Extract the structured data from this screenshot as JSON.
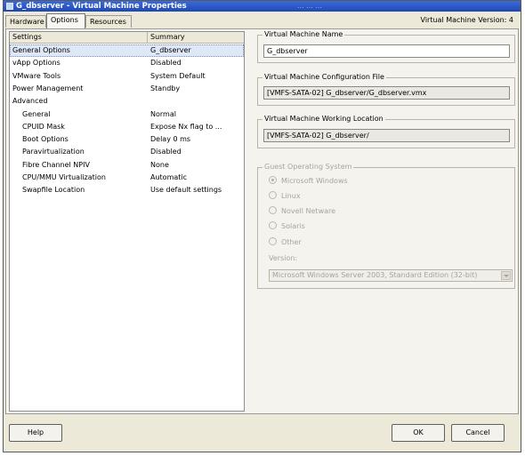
{
  "window": {
    "title": "G_dbserver - Virtual Machine Properties",
    "title_ghost": "... ... ..."
  },
  "tabs": [
    {
      "label": "Hardware",
      "active": false
    },
    {
      "label": "Options",
      "active": true
    },
    {
      "label": "Resources",
      "active": false
    }
  ],
  "version_label": "Virtual Machine Version: 4",
  "settings_table": {
    "columns": [
      "Settings",
      "Summary"
    ],
    "rows": [
      {
        "setting": "General Options",
        "summary": "G_dbserver",
        "indent": false,
        "selected": true
      },
      {
        "setting": "vApp Options",
        "summary": "Disabled",
        "indent": false,
        "selected": false
      },
      {
        "setting": "VMware Tools",
        "summary": "System Default",
        "indent": false,
        "selected": false
      },
      {
        "setting": "Power Management",
        "summary": "Standby",
        "indent": false,
        "selected": false
      },
      {
        "setting": "Advanced",
        "summary": "",
        "indent": false,
        "selected": false
      },
      {
        "setting": "General",
        "summary": "Normal",
        "indent": true,
        "selected": false
      },
      {
        "setting": "CPUID Mask",
        "summary": "Expose Nx flag to ...",
        "indent": true,
        "selected": false
      },
      {
        "setting": "Boot Options",
        "summary": "Delay 0 ms",
        "indent": true,
        "selected": false
      },
      {
        "setting": "Paravirtualization",
        "summary": "Disabled",
        "indent": true,
        "selected": false
      },
      {
        "setting": "Fibre Channel NPIV",
        "summary": "None",
        "indent": true,
        "selected": false
      },
      {
        "setting": "CPU/MMU Virtualization",
        "summary": "Automatic",
        "indent": true,
        "selected": false
      },
      {
        "setting": "Swapfile Location",
        "summary": "Use default settings",
        "indent": true,
        "selected": false
      }
    ]
  },
  "vm_name": {
    "label": "Virtual Machine Name",
    "value": "G_dbserver"
  },
  "config_file": {
    "label": "Virtual Machine Configuration File",
    "value": "[VMFS-SATA-02] G_dbserver/G_dbserver.vmx"
  },
  "working_location": {
    "label": "Virtual Machine Working Location",
    "value": "[VMFS-SATA-02] G_dbserver/"
  },
  "guest_os": {
    "label": "Guest Operating System",
    "options": [
      {
        "label": "Microsoft Windows",
        "checked": true
      },
      {
        "label": "Linux",
        "checked": false
      },
      {
        "label": "Novell Netware",
        "checked": false
      },
      {
        "label": "Solaris",
        "checked": false
      },
      {
        "label": "Other",
        "checked": false
      }
    ],
    "version_label": "Version:",
    "version_value": "Microsoft Windows Server 2003, Standard Edition (32-bit)"
  },
  "buttons": {
    "help": "Help",
    "ok": "OK",
    "cancel": "Cancel"
  }
}
